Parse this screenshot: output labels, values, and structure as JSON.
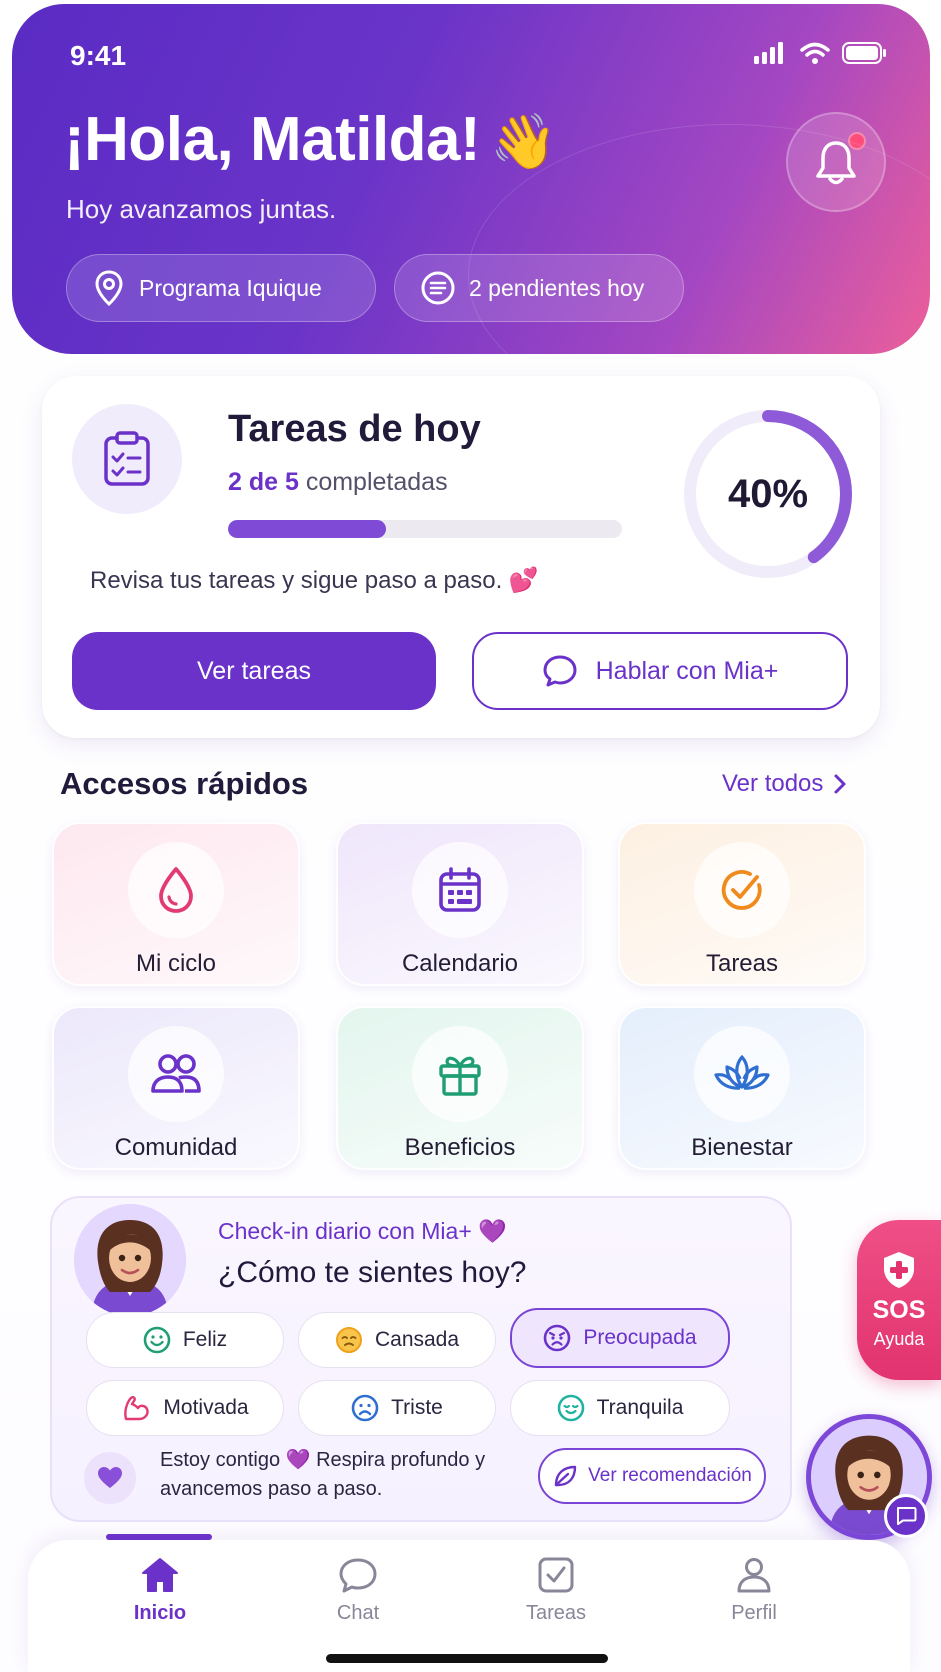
{
  "status_bar": {
    "time": "9:41"
  },
  "header": {
    "greeting": "¡Hola, Matilda!",
    "wave_emoji": "👋",
    "subtitle": "Hoy avanzamos juntas.",
    "program_pill": "Programa Iquique",
    "pending_pill": "2 pendientes hoy",
    "notification_dot": true
  },
  "tasks_card": {
    "title": "Tareas de hoy",
    "completed_highlight": "2 de 5",
    "completed_suffix": " completadas",
    "progress_fraction": 0.4,
    "percent_label": "40%",
    "note": "Revisa tus tareas y sigue paso a paso. 💕",
    "primary_button": "Ver tareas",
    "secondary_button": "Hablar con Mia+"
  },
  "quick_access": {
    "title": "Accesos rápidos",
    "see_all": "Ver todos",
    "tiles": [
      {
        "label": "Mi ciclo",
        "icon": "drop-icon",
        "bg": "#fde8ef",
        "color": "#e23a72"
      },
      {
        "label": "Calendario",
        "icon": "calendar-icon",
        "bg": "#efe6fb",
        "color": "#6a32c9"
      },
      {
        "label": "Tareas",
        "icon": "check-circle-icon",
        "bg": "#fdf0e2",
        "color": "#f08a1c"
      },
      {
        "label": "Comunidad",
        "icon": "users-icon",
        "bg": "#ece8fb",
        "color": "#6a32c9"
      },
      {
        "label": "Beneficios",
        "icon": "gift-icon",
        "bg": "#e3f5ee",
        "color": "#1f9e74"
      },
      {
        "label": "Bienestar",
        "icon": "lotus-icon",
        "bg": "#e4eefc",
        "color": "#2f6fd1"
      }
    ]
  },
  "checkin": {
    "eyebrow": "Check-in diario con Mia+ 💜",
    "title": "¿Cómo te sientes hoy?",
    "moods": [
      {
        "label": "Feliz",
        "icon": "smile-icon",
        "color": "#1f9e74"
      },
      {
        "label": "Cansada",
        "icon": "tired-face-icon",
        "color": "#f0a01c"
      },
      {
        "label": "Preocupada",
        "icon": "worried-face-icon",
        "color": "#6a32c9",
        "selected": true
      },
      {
        "label": "Motivada",
        "icon": "flexed-arm-icon",
        "color": "#e23a72"
      },
      {
        "label": "Triste",
        "icon": "sad-face-icon",
        "color": "#2f6fd1"
      },
      {
        "label": "Tranquila",
        "icon": "calm-face-icon",
        "color": "#1fb3a0"
      }
    ],
    "reassurance": "Estoy contigo 💜 Respira profundo y avancemos paso a paso.",
    "recommendation_button": "Ver recomendación"
  },
  "sos": {
    "title": "SOS",
    "subtitle": "Ayuda"
  },
  "bottom_nav": {
    "items": [
      {
        "label": "Inicio",
        "icon": "home-icon",
        "active": true
      },
      {
        "label": "Chat",
        "icon": "chat-icon",
        "active": false
      },
      {
        "label": "Tareas",
        "icon": "checkbox-icon",
        "active": false
      },
      {
        "label": "Perfil",
        "icon": "user-icon",
        "active": false
      }
    ]
  },
  "colors": {
    "primary": "#6a32c9",
    "accent_pink": "#e2336f"
  }
}
